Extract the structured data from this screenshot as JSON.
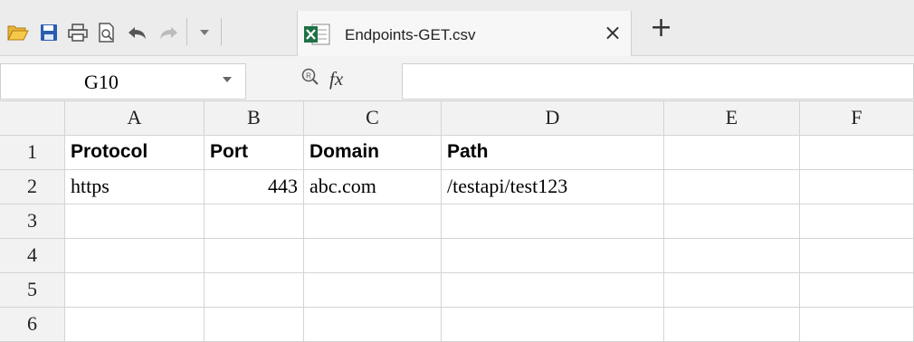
{
  "toolbar": {
    "icons": [
      "open-folder-icon",
      "save-icon",
      "print-icon",
      "print-preview-icon",
      "undo-icon",
      "redo-icon",
      "customize-dropdown-icon"
    ]
  },
  "tab": {
    "filename": "Endpoints-GET.csv",
    "close_glyph": "×",
    "add_glyph": "+"
  },
  "formula_bar": {
    "cell_ref": "G10",
    "fx_label": "fx",
    "formula": ""
  },
  "sheet": {
    "columns": [
      "A",
      "B",
      "C",
      "D",
      "E",
      "F"
    ],
    "rows": [
      "1",
      "2",
      "3",
      "4",
      "5",
      "6"
    ],
    "cells": {
      "A1": "Protocol",
      "B1": "Port",
      "C1": "Domain",
      "D1": "Path",
      "A2": "https",
      "B2": "443",
      "C2": "abc.com",
      "D2": "/testapi/test123"
    },
    "colors": {
      "header_bg": "#f2f2f2",
      "gridline": "#d4d4d4",
      "folder": "#e8b33a",
      "save": "#2a5db0",
      "excel_green": "#1e7145"
    }
  }
}
